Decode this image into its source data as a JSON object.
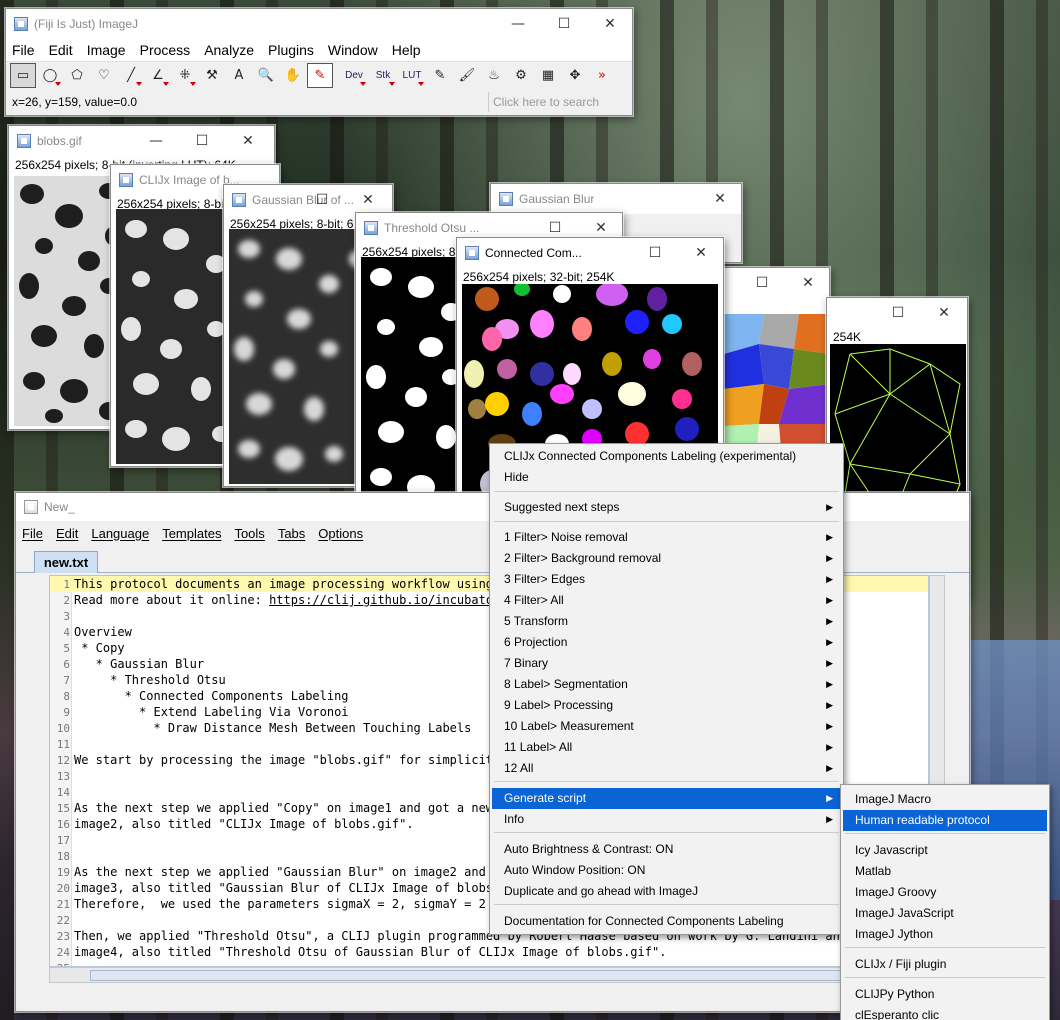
{
  "imagej": {
    "title": "(Fiji Is Just) ImageJ",
    "menus": [
      "File",
      "Edit",
      "Image",
      "Process",
      "Analyze",
      "Plugins",
      "Window",
      "Help"
    ],
    "tools": [
      {
        "name": "rectangle-tool-icon",
        "glyph": "▭"
      },
      {
        "name": "oval-tool-icon",
        "glyph": "◯"
      },
      {
        "name": "polygon-tool-icon",
        "glyph": "⬠"
      },
      {
        "name": "freehand-tool-icon",
        "glyph": "♡"
      },
      {
        "name": "line-tool-icon",
        "glyph": "╱"
      },
      {
        "name": "angle-tool-icon",
        "glyph": "∠"
      },
      {
        "name": "point-tool-icon",
        "glyph": "⁜"
      },
      {
        "name": "wand-tool-icon",
        "glyph": "⚒"
      },
      {
        "name": "text-tool-icon",
        "glyph": "A"
      },
      {
        "name": "zoom-tool-icon",
        "glyph": "🔍"
      },
      {
        "name": "hand-tool-icon",
        "glyph": "✋"
      },
      {
        "name": "color-picker-icon",
        "glyph": "✎"
      }
    ],
    "text_tools": [
      "Dev",
      "Stk",
      "LUT"
    ],
    "tools2": [
      {
        "name": "pencil-tool-icon",
        "glyph": "✎"
      },
      {
        "name": "brush-tool-icon",
        "glyph": "🖌"
      },
      {
        "name": "flood-fill-tool-icon",
        "glyph": "♨"
      },
      {
        "name": "magic-tool-icon",
        "glyph": "⚙"
      },
      {
        "name": "lut-icon",
        "glyph": "▦"
      },
      {
        "name": "move-icon",
        "glyph": "✥"
      },
      {
        "name": "more-tools-icon",
        "glyph": "»"
      }
    ],
    "status": "x=26, y=159, value=0.0",
    "search_placeholder": "Click here to search"
  },
  "windows": {
    "blobs": {
      "title": "blobs.gif",
      "info": "256x254 pixels; 8-bit (inverting LUT); 64K"
    },
    "clijx": {
      "title": "CLIJx Image of b...",
      "info": "256x254 pixels; 8-bit"
    },
    "gauss": {
      "title": "Gaussian Blur of ...",
      "info": "256x254 pixels; 8-bit; 6"
    },
    "gaussdlg": {
      "title": "Gaussian Blur"
    },
    "thresh": {
      "title": "Threshold Otsu ...",
      "info": "256x254 pixels; 8"
    },
    "cc": {
      "title": "Connected Com...",
      "info": "256x254 pixels; 32-bit; 254K"
    },
    "mesh": {
      "info": "254K"
    }
  },
  "editor": {
    "title": "New_",
    "menus": [
      "File",
      "Edit",
      "Language",
      "Templates",
      "Tools",
      "Tabs",
      "Options"
    ],
    "tab": "new.txt",
    "lines": [
      {
        "n": "1",
        "t": "This protocol documents an image processing workflow using C"
      },
      {
        "n": "2",
        "t": "Read more about it online: ",
        "url": "https://clij.github.io/incubator/"
      },
      {
        "n": "3",
        "t": ""
      },
      {
        "n": "4",
        "t": "Overview"
      },
      {
        "n": "5",
        "t": " * Copy"
      },
      {
        "n": "6",
        "t": "   * Gaussian Blur"
      },
      {
        "n": "7",
        "t": "     * Threshold Otsu"
      },
      {
        "n": "8",
        "t": "       * Connected Components Labeling"
      },
      {
        "n": "9",
        "t": "         * Extend Labeling Via Voronoi"
      },
      {
        "n": "10",
        "t": "           * Draw Distance Mesh Between Touching Labels"
      },
      {
        "n": "11",
        "t": ""
      },
      {
        "n": "12",
        "t": "We start by processing the image \"blobs.gif\" for simplicity"
      },
      {
        "n": "13",
        "t": ""
      },
      {
        "n": "14",
        "t": ""
      },
      {
        "n": "15",
        "t": "As the next step we applied \"Copy\" on image1 and got a new i"
      },
      {
        "n": "16",
        "t": "image2, also titled \"CLIJx Image of blobs.gif\"."
      },
      {
        "n": "17",
        "t": ""
      },
      {
        "n": "18",
        "t": ""
      },
      {
        "n": "19",
        "t": "As the next step we applied \"Gaussian Blur\" on image2 and go"
      },
      {
        "n": "20",
        "t": "image3, also titled \"Gaussian Blur of CLIJx Image of blobs.g"
      },
      {
        "n": "21",
        "t": "Therefore,  we used the parameters sigmaX = 2, sigmaY = 2 an"
      },
      {
        "n": "22",
        "t": ""
      },
      {
        "n": "23",
        "t": "Then, we applied \"Threshold Otsu\", a CLIJ plugin programmed by Robert Haase based on work by G. Landini and W"
      },
      {
        "n": "24",
        "t": "image4, also titled \"Threshold Otsu of Gaussian Blur of CLIJx Image of blobs.gif\"."
      },
      {
        "n": "25",
        "t": ""
      }
    ]
  },
  "context_menu": {
    "items": [
      {
        "label": "CLIJx Connected Components Labeling (experimental)",
        "arrow": false
      },
      {
        "label": "Hide",
        "arrow": false
      },
      {
        "label": "Suggested next steps",
        "arrow": true
      },
      {
        "label": "1 Filter> Noise removal",
        "arrow": true
      },
      {
        "label": "2 Filter> Background removal",
        "arrow": true
      },
      {
        "label": "3 Filter> Edges",
        "arrow": true
      },
      {
        "label": "4 Filter> All",
        "arrow": true
      },
      {
        "label": "5 Transform",
        "arrow": true
      },
      {
        "label": "6 Projection",
        "arrow": true
      },
      {
        "label": "7 Binary",
        "arrow": true
      },
      {
        "label": "8 Label> Segmentation",
        "arrow": true
      },
      {
        "label": "9 Label> Processing",
        "arrow": true
      },
      {
        "label": "10 Label> Measurement",
        "arrow": true
      },
      {
        "label": "11 Label> All",
        "arrow": true
      },
      {
        "label": "12 All",
        "arrow": true
      },
      {
        "label": "Generate script",
        "arrow": true,
        "highlight": true
      },
      {
        "label": "Info",
        "arrow": true
      },
      {
        "label": "Auto Brightness & Contrast: ON",
        "arrow": false
      },
      {
        "label": "Auto Window Position: ON",
        "arrow": false
      },
      {
        "label": "Duplicate and go ahead with ImageJ",
        "arrow": false
      },
      {
        "label": "Documentation for Connected Components Labeling",
        "arrow": false
      }
    ]
  },
  "submenu": {
    "items": [
      {
        "label": "ImageJ Macro"
      },
      {
        "label": "Human readable protocol",
        "highlight": true
      },
      {
        "label": "Icy Javascript"
      },
      {
        "label": "Matlab"
      },
      {
        "label": "ImageJ Groovy"
      },
      {
        "label": "ImageJ JavaScript"
      },
      {
        "label": "ImageJ Jython"
      },
      {
        "label": "CLIJx / Fiji plugin"
      },
      {
        "label": "CLIJPy Python"
      },
      {
        "label": "clEsperanto clic"
      }
    ]
  },
  "colors": {
    "highlight": "#0a64d6",
    "line_highlight": "#fff9b0"
  }
}
